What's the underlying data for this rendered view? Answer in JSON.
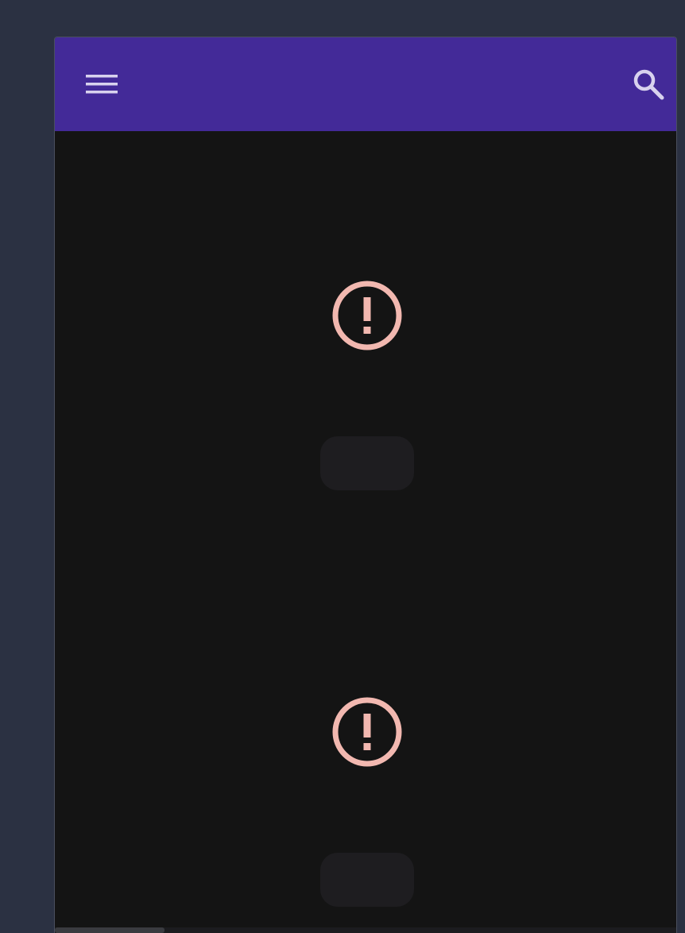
{
  "app_bar": {
    "background": "#432a98",
    "menu_icon": "hamburger-menu-icon",
    "search_icon": "search-icon",
    "icon_color": "#d8d2ee"
  },
  "content": {
    "background": "#141414",
    "error_states": [
      {
        "icon": "error-exclamation-circle-icon",
        "icon_color": "#f2b8b0",
        "retry_label": ""
      },
      {
        "icon": "error-exclamation-circle-icon",
        "icon_color": "#f2b8b0",
        "retry_label": ""
      }
    ]
  },
  "page_background": "#2b3142"
}
